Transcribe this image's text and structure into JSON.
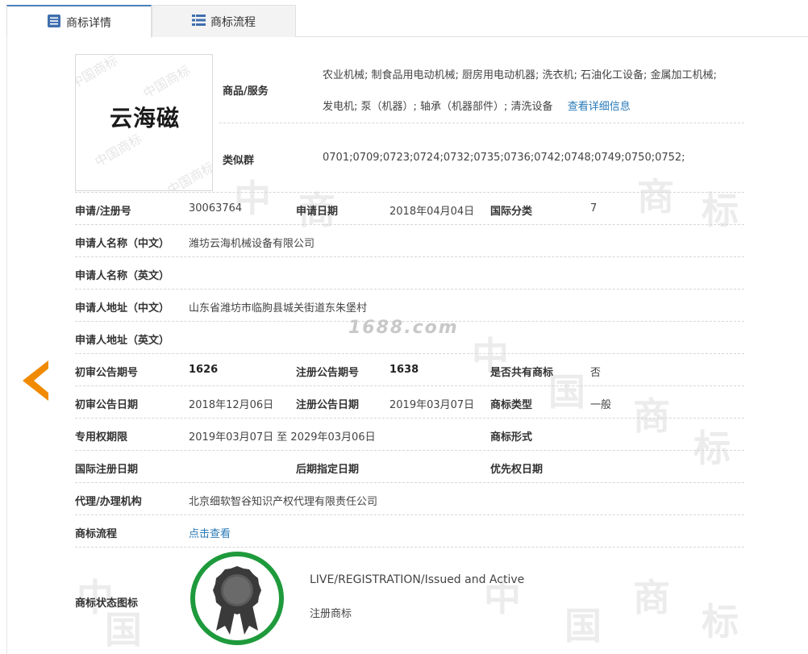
{
  "tabs": [
    {
      "label": "商标详情",
      "icon": "document-list-icon",
      "active": true
    },
    {
      "label": "商标流程",
      "icon": "grid-list-icon",
      "active": false
    }
  ],
  "logo": {
    "text": "云海磁",
    "watermark": "中国商标"
  },
  "goods": {
    "label": "商品/服务",
    "line1": "农业机械; 制食品用电动机械; 厨房用电动机器; 洗衣机; 石油化工设备; 金属加工机械;",
    "line2": "发电机; 泵（机器）; 轴承（机器部件）; 清洗设备",
    "detail_link": "查看详细信息"
  },
  "similar_group": {
    "label": "类似群",
    "value": "0701;0709;0723;0724;0732;0735;0736;0742;0748;0749;0750;0752;"
  },
  "rows": {
    "reg_no_label": "申请/注册号",
    "reg_no": "30063764",
    "apply_date_label": "申请日期",
    "apply_date": "2018年04月04日",
    "intl_class_label": "国际分类",
    "intl_class": "7",
    "applicant_cn_label": "申请人名称（中文）",
    "applicant_cn": "潍坊云海机械设备有限公司",
    "applicant_en_label": "申请人名称（英文）",
    "applicant_en": "",
    "address_cn_label": "申请人地址（中文）",
    "address_cn": "山东省潍坊市临朐县城关街道东朱堡村",
    "address_en_label": "申请人地址（英文）",
    "address_en": "",
    "prelim_no_label": "初审公告期号",
    "prelim_no": "1626",
    "reg_pub_no_label": "注册公告期号",
    "reg_pub_no": "1638",
    "shared_label": "是否共有商标",
    "shared": "否",
    "prelim_date_label": "初审公告日期",
    "prelim_date": "2018年12月06日",
    "reg_pub_date_label": "注册公告日期",
    "reg_pub_date": "2019年03月07日",
    "tm_type_label": "商标类型",
    "tm_type": "一般",
    "term_label": "专用权期限",
    "term": "2019年03月07日 至 2029年03月06日",
    "tm_form_label": "商标形式",
    "tm_form": "",
    "intl_reg_date_label": "国际注册日期",
    "intl_reg_date": "",
    "later_date_label": "后期指定日期",
    "later_date": "",
    "priority_date_label": "优先权日期",
    "priority_date": "",
    "agent_label": "代理/办理机构",
    "agent": "北京细软智谷知识产权代理有限责任公司",
    "flow_label": "商标流程",
    "flow_link": "点击查看"
  },
  "status": {
    "label": "商标状态图标",
    "line1": "LIVE/REGISTRATION/Issued and Active",
    "line2": "注册商标",
    "badge_icon": "award-ribbon-icon",
    "badge_color": "#1e9a3c"
  },
  "watermark_site": "1688.com",
  "watermark_bg": [
    "中",
    "国",
    "商",
    "标"
  ],
  "colors": {
    "accent": "#2a7ab8",
    "arrow": "#f08a00",
    "tab_active_top": "#4a7ebb"
  },
  "nav": {
    "prev_icon": "chevron-left-icon"
  }
}
